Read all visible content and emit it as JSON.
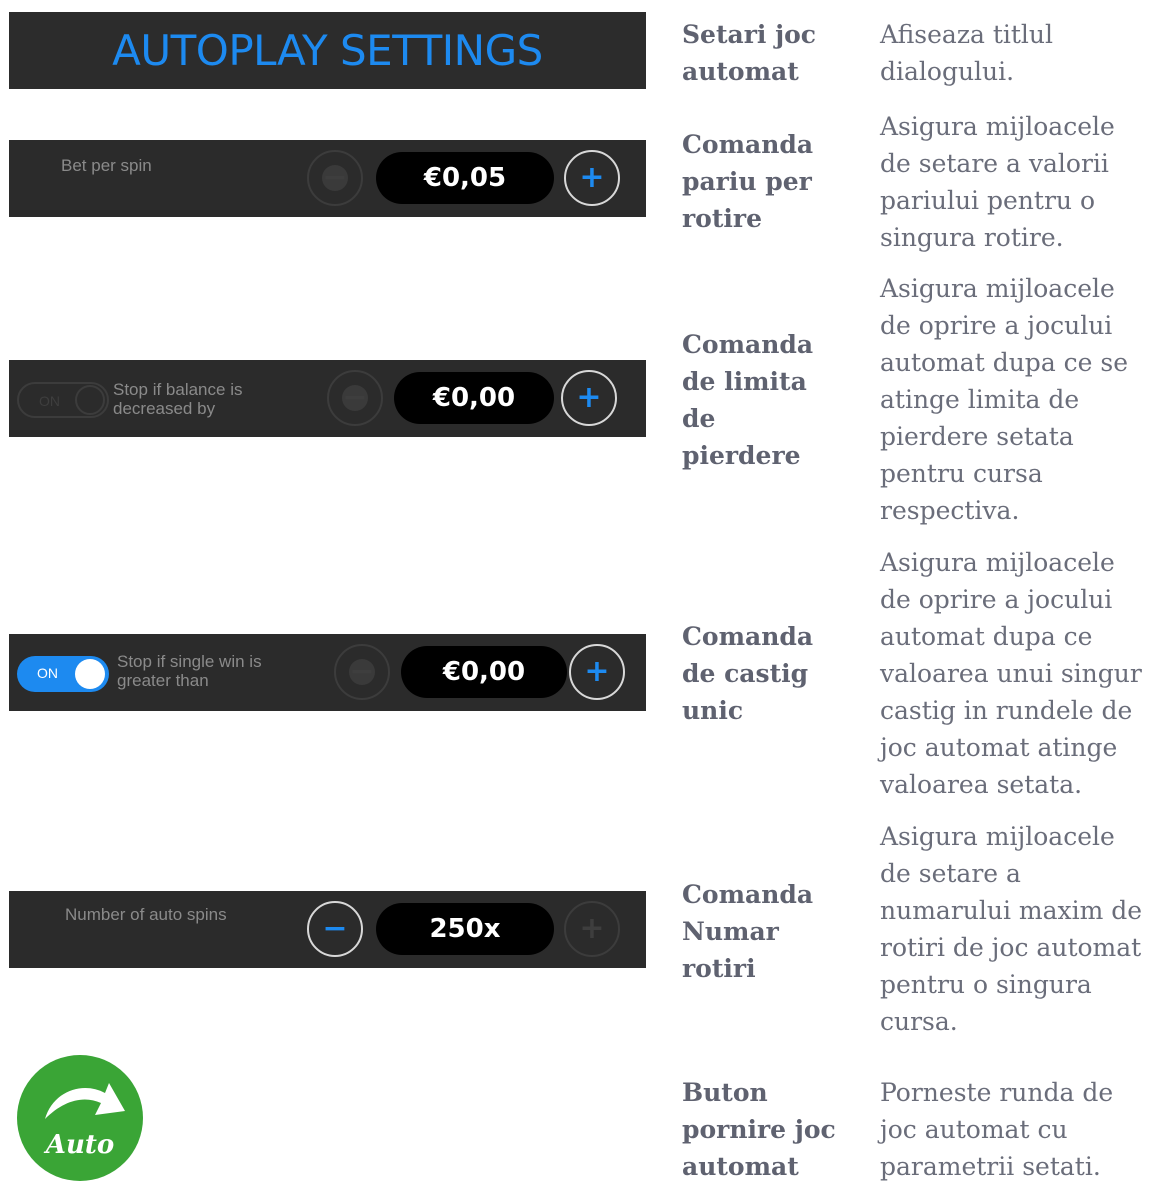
{
  "rows": [
    {
      "term": [
        "Setari joc",
        "automat"
      ],
      "desc": [
        "Afiseaza titlul",
        "dialogului."
      ],
      "control": {
        "title": "AUTOPLAY SETTINGS"
      }
    },
    {
      "term": [
        "Comanda",
        "pariu per",
        "rotire"
      ],
      "desc": [
        "Asigura mijloacele",
        "de setare a valorii",
        "pariului pentru o",
        "singura rotire."
      ],
      "control": {
        "label": "Bet per spin",
        "value": "€0,05",
        "minus": "−",
        "plus": "+"
      }
    },
    {
      "term": [
        "Comanda",
        "de limita",
        "de",
        "pierdere"
      ],
      "desc": [
        "Asigura mijloacele",
        "de oprire a jocului",
        "automat dupa ce se",
        "atinge limita de",
        "pierdere setata",
        "pentru cursa",
        "respectiva."
      ],
      "control": {
        "toggle": "ON",
        "toggle_state": "off",
        "label": [
          "Stop if balance is",
          "decreased by"
        ],
        "value": "€0,00",
        "minus": "−",
        "plus": "+"
      }
    },
    {
      "term": [
        "Comanda",
        "de castig",
        "unic"
      ],
      "desc": [
        "Asigura mijloacele",
        "de oprire a jocului",
        "automat dupa ce",
        "valoarea unui singur",
        "castig in rundele de",
        "joc automat atinge",
        "valoarea setata."
      ],
      "control": {
        "toggle": "ON",
        "toggle_state": "on",
        "label": [
          "Stop if single win is",
          "greater than"
        ],
        "value": "€0,00",
        "minus": "−",
        "plus": "+"
      }
    },
    {
      "term": [
        "Comanda",
        "Numar",
        "rotiri"
      ],
      "desc": [
        "Asigura mijloacele",
        "de setare a",
        "numarului maxim de",
        "rotiri de joc automat",
        "pentru o singura",
        "cursa."
      ],
      "control": {
        "label": "Number of auto spins",
        "value": "250x",
        "minus": "−",
        "plus": "+"
      }
    },
    {
      "term": [
        "Buton",
        "pornire joc",
        "automat"
      ],
      "desc": [
        "Porneste runda de",
        "joc automat cu",
        "parametrii setati."
      ],
      "control": {
        "label": "Auto"
      }
    }
  ],
  "colors": {
    "accent": "#1d8af0",
    "bar_bg": "#2b2b2b",
    "auto_green": "#3aa536",
    "term_text": "#5f6270"
  }
}
